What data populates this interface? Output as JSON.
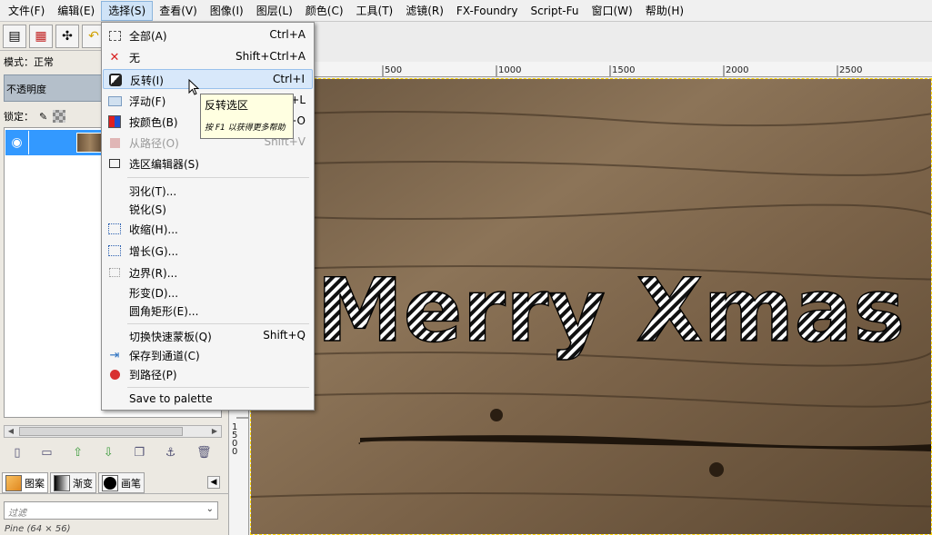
{
  "menubar": {
    "items": [
      {
        "label": "文件(F)"
      },
      {
        "label": "编辑(E)"
      },
      {
        "label": "选择(S)",
        "active": true
      },
      {
        "label": "查看(V)"
      },
      {
        "label": "图像(I)"
      },
      {
        "label": "图层(L)"
      },
      {
        "label": "颜色(C)"
      },
      {
        "label": "工具(T)"
      },
      {
        "label": "滤镜(R)"
      },
      {
        "label": "FX-Foundry"
      },
      {
        "label": "Script-Fu"
      },
      {
        "label": "窗口(W)"
      },
      {
        "label": "帮助(H)"
      }
    ]
  },
  "layers_panel": {
    "mode_label": "模式：",
    "mode_value": "正常",
    "opacity_label": "不透明度",
    "lock_label": "锁定："
  },
  "resources": {
    "tabs": [
      {
        "label": "图案",
        "icon": "pattern-swatch-icon"
      },
      {
        "label": "渐变",
        "icon": "gradient-swatch-icon"
      },
      {
        "label": "画笔",
        "icon": "brush-swatch-icon"
      }
    ],
    "filter_placeholder": "过滤",
    "pattern_name": "Pine (64 × 56)"
  },
  "rulers": {
    "h_ticks": [
      "500",
      "1000",
      "1500",
      "2000",
      "2500"
    ],
    "v_ticks": [
      "1",
      "5",
      "0",
      "0"
    ]
  },
  "canvas_text": "Merry Xmas",
  "select_menu": {
    "items": [
      {
        "label": "全部(A)",
        "shortcut": "Ctrl+A",
        "icon": "select-all-icon"
      },
      {
        "label": "无",
        "shortcut": "Shift+Ctrl+A",
        "icon": "select-none-icon"
      },
      {
        "label": "反转(I)",
        "shortcut": "Ctrl+I",
        "icon": "invert-selection-icon",
        "highlighted": true
      },
      {
        "label": "浮动(F)",
        "shortcut": "Shift+Ctrl+L",
        "icon": "float-selection-icon"
      },
      {
        "label": "按颜色(B)",
        "shortcut": "Shift+O",
        "icon": "select-by-color-icon"
      },
      {
        "label": "从路径(O)",
        "shortcut": "Shift+V",
        "icon": "from-path-icon",
        "disabled": true
      },
      {
        "label": "选区编辑器(S)",
        "shortcut": "",
        "icon": "selection-editor-icon"
      },
      {
        "label": "羽化(T)...",
        "shortcut": "",
        "icon": ""
      },
      {
        "label": "锐化(S)",
        "shortcut": "",
        "icon": ""
      },
      {
        "label": "收缩(H)...",
        "shortcut": "",
        "icon": "shrink-icon"
      },
      {
        "label": "增长(G)...",
        "shortcut": "",
        "icon": "grow-icon"
      },
      {
        "label": "边界(R)...",
        "shortcut": "",
        "icon": "border-icon"
      },
      {
        "label": "形变(D)...",
        "shortcut": "",
        "icon": ""
      },
      {
        "label": "圆角矩形(E)...",
        "shortcut": "",
        "icon": ""
      },
      {
        "label": "切换快速蒙板(Q)",
        "shortcut": "Shift+Q",
        "icon": ""
      },
      {
        "label": "保存到通道(C)",
        "shortcut": "",
        "icon": "save-to-channel-icon"
      },
      {
        "label": "到路径(P)",
        "shortcut": "",
        "icon": "to-path-icon"
      },
      {
        "label": "Save to palette",
        "shortcut": "",
        "icon": ""
      }
    ]
  },
  "tooltip": {
    "title": "反转选区",
    "hint": "按 F1 以获得更多帮助"
  },
  "colors": {
    "menu_highlight": "#d8e8fa",
    "layer_selected": "#3399ff",
    "tooltip_bg": "#ffffe1"
  }
}
